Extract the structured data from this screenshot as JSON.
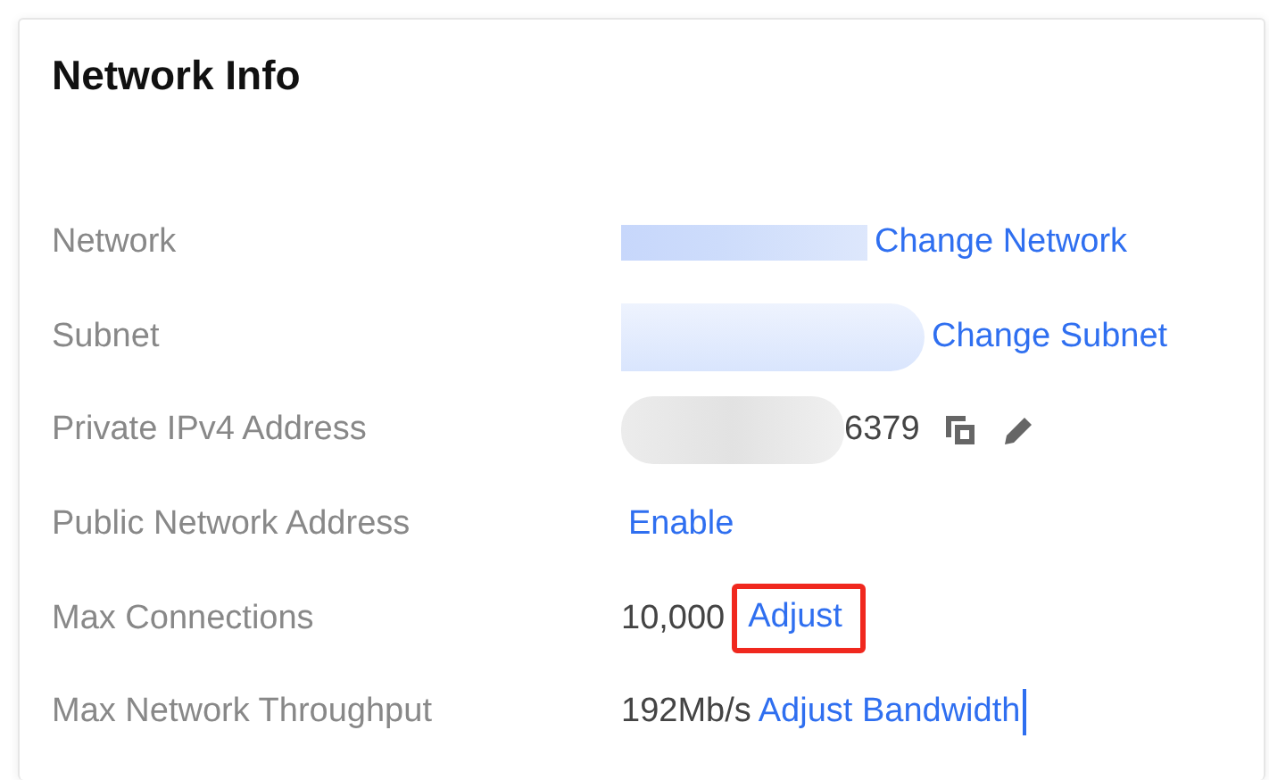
{
  "card": {
    "title": "Network Info"
  },
  "rows": [
    {
      "label": "Network",
      "mask": {
        "kind": "bar"
      },
      "link": {
        "text": "Change Network",
        "highlighted": false
      }
    },
    {
      "label": "Subnet",
      "mask": {
        "kind": "cloud"
      },
      "link": {
        "text": "Change Subnet",
        "highlighted": false
      }
    },
    {
      "label": "Private IPv4 Address",
      "mask": {
        "kind": "grey"
      },
      "value": "6379",
      "icons": [
        {
          "kind": "copy"
        },
        {
          "kind": "edit"
        }
      ]
    },
    {
      "label": "Public Network Address",
      "link": {
        "text": "Enable",
        "highlighted": false
      }
    },
    {
      "label": "Max Connections",
      "value": "10,000",
      "link": {
        "text": "Adjust",
        "highlighted": true
      }
    },
    {
      "label": "Max Network Throughput",
      "value": "192Mb/s",
      "link": {
        "text": "Adjust Bandwidth",
        "highlighted": false,
        "caret": true
      }
    }
  ]
}
